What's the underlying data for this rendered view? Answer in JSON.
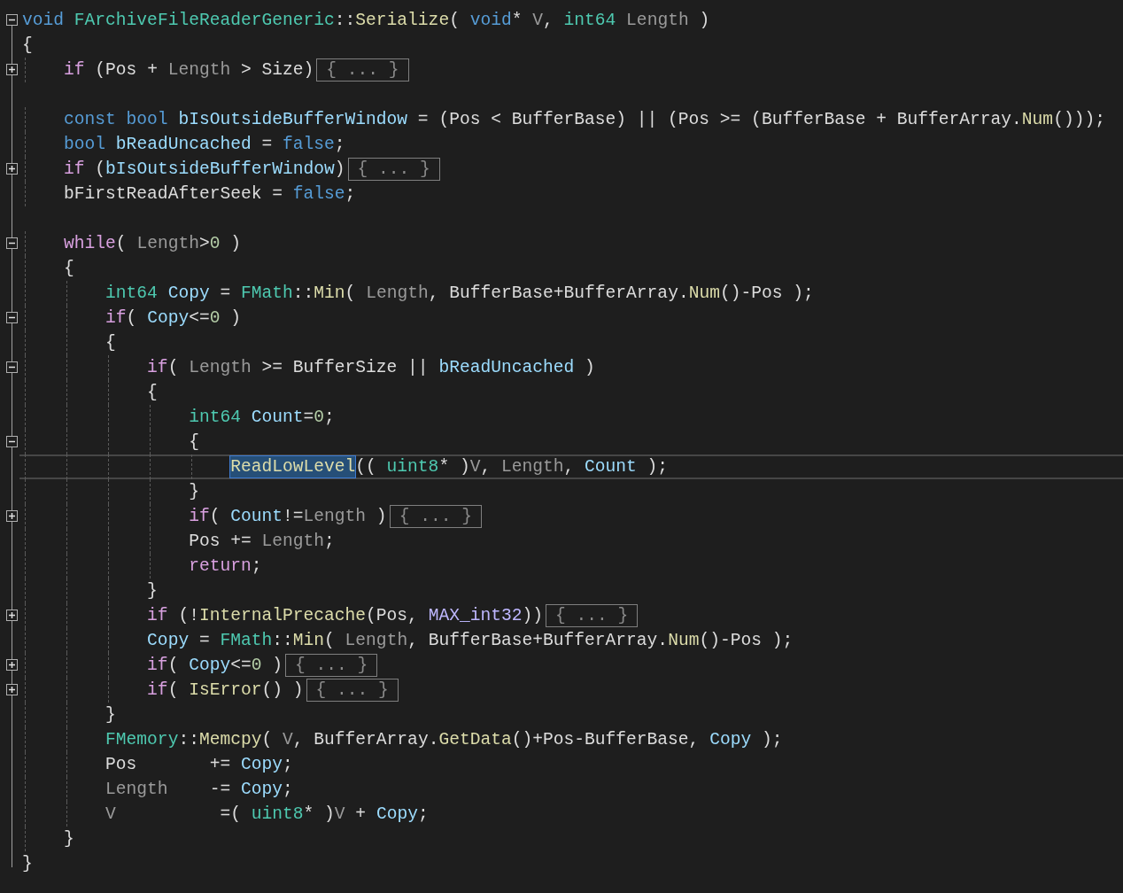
{
  "editor": {
    "lines": [
      {
        "kind": "code",
        "expanded": true,
        "tokens": [
          {
            "text": "void ",
            "kind": "kw"
          },
          {
            "text": "FArchiveFileReaderGeneric",
            "kind": "type"
          },
          {
            "text": "::",
            "kind": "plain"
          },
          {
            "text": "Serialize",
            "kind": "fn"
          },
          {
            "text": "( ",
            "kind": "plain"
          },
          {
            "text": "void",
            "kind": "kw"
          },
          {
            "text": "* ",
            "kind": "plain"
          },
          {
            "text": "V",
            "kind": "param"
          },
          {
            "text": ", ",
            "kind": "plain"
          },
          {
            "text": "int64 ",
            "kind": "type"
          },
          {
            "text": "Length",
            "kind": "param"
          },
          {
            "text": " )",
            "kind": "plain"
          }
        ]
      },
      {
        "kind": "code",
        "tokens": [
          {
            "text": "{",
            "kind": "plain"
          }
        ]
      },
      {
        "kind": "code",
        "expanded": false,
        "collapsed_text": "{ ... }",
        "tokens": [
          {
            "text": "    if",
            "kind": "ctrl"
          },
          {
            "text": " (Pos + ",
            "kind": "plain"
          },
          {
            "text": "Length",
            "kind": "param"
          },
          {
            "text": " > Size)",
            "kind": "plain"
          }
        ]
      },
      {
        "kind": "blank"
      },
      {
        "kind": "code",
        "tokens": [
          {
            "text": "    const bool ",
            "kind": "kw"
          },
          {
            "text": "bIsOutsideBufferWindow",
            "kind": "local"
          },
          {
            "text": " = (Pos < BufferBase) || (Pos >= (BufferBase + BufferArray.",
            "kind": "plain"
          },
          {
            "text": "Num",
            "kind": "fn"
          },
          {
            "text": "()));",
            "kind": "plain"
          }
        ]
      },
      {
        "kind": "code",
        "tokens": [
          {
            "text": "    bool ",
            "kind": "kw"
          },
          {
            "text": "bReadUncached",
            "kind": "local"
          },
          {
            "text": " = ",
            "kind": "plain"
          },
          {
            "text": "false",
            "kind": "kw"
          },
          {
            "text": ";",
            "kind": "plain"
          }
        ]
      },
      {
        "kind": "code",
        "expanded": false,
        "collapsed_text": "{ ... }",
        "tokens": [
          {
            "text": "    if",
            "kind": "ctrl"
          },
          {
            "text": " (",
            "kind": "plain"
          },
          {
            "text": "bIsOutsideBufferWindow",
            "kind": "local"
          },
          {
            "text": ")",
            "kind": "plain"
          }
        ]
      },
      {
        "kind": "code",
        "tokens": [
          {
            "text": "    bFirstReadAfterSeek = ",
            "kind": "plain"
          },
          {
            "text": "false",
            "kind": "kw"
          },
          {
            "text": ";",
            "kind": "plain"
          }
        ]
      },
      {
        "kind": "blank"
      },
      {
        "kind": "code",
        "expanded": true,
        "tokens": [
          {
            "text": "    while",
            "kind": "ctrl"
          },
          {
            "text": "( ",
            "kind": "plain"
          },
          {
            "text": "Length",
            "kind": "param"
          },
          {
            "text": ">",
            "kind": "plain"
          },
          {
            "text": "0",
            "kind": "num"
          },
          {
            "text": " )",
            "kind": "plain"
          }
        ]
      },
      {
        "kind": "code",
        "tokens": [
          {
            "text": "    {",
            "kind": "plain"
          }
        ]
      },
      {
        "kind": "code",
        "tokens": [
          {
            "text": "        int64 ",
            "kind": "type"
          },
          {
            "text": "Copy",
            "kind": "local"
          },
          {
            "text": " = ",
            "kind": "plain"
          },
          {
            "text": "FMath",
            "kind": "type"
          },
          {
            "text": "::",
            "kind": "plain"
          },
          {
            "text": "Min",
            "kind": "fn"
          },
          {
            "text": "( ",
            "kind": "plain"
          },
          {
            "text": "Length",
            "kind": "param"
          },
          {
            "text": ", BufferBase+BufferArray.",
            "kind": "plain"
          },
          {
            "text": "Num",
            "kind": "fn"
          },
          {
            "text": "()-Pos );",
            "kind": "plain"
          }
        ]
      },
      {
        "kind": "code",
        "expanded": true,
        "tokens": [
          {
            "text": "        if",
            "kind": "ctrl"
          },
          {
            "text": "( ",
            "kind": "plain"
          },
          {
            "text": "Copy",
            "kind": "local"
          },
          {
            "text": "<=",
            "kind": "plain"
          },
          {
            "text": "0",
            "kind": "num"
          },
          {
            "text": " )",
            "kind": "plain"
          }
        ]
      },
      {
        "kind": "code",
        "tokens": [
          {
            "text": "        {",
            "kind": "plain"
          }
        ]
      },
      {
        "kind": "code",
        "expanded": true,
        "tokens": [
          {
            "text": "            if",
            "kind": "ctrl"
          },
          {
            "text": "( ",
            "kind": "plain"
          },
          {
            "text": "Length",
            "kind": "param"
          },
          {
            "text": " >= BufferSize || ",
            "kind": "plain"
          },
          {
            "text": "bReadUncached",
            "kind": "local"
          },
          {
            "text": " )",
            "kind": "plain"
          }
        ]
      },
      {
        "kind": "code",
        "tokens": [
          {
            "text": "            {",
            "kind": "plain"
          }
        ]
      },
      {
        "kind": "code",
        "tokens": [
          {
            "text": "                int64 ",
            "kind": "type"
          },
          {
            "text": "Count",
            "kind": "local"
          },
          {
            "text": "=",
            "kind": "plain"
          },
          {
            "text": "0",
            "kind": "num"
          },
          {
            "text": ";",
            "kind": "plain"
          }
        ]
      },
      {
        "kind": "code",
        "expanded": true,
        "tokens": [
          {
            "text": "                {",
            "kind": "plain"
          }
        ]
      },
      {
        "kind": "code",
        "current": true,
        "tokens": [
          {
            "text": "                    ReadLowLevel",
            "kind": "fn",
            "highlighted": true
          },
          {
            "text": "(( ",
            "kind": "plain"
          },
          {
            "text": "uint8",
            "kind": "type"
          },
          {
            "text": "* )",
            "kind": "plain"
          },
          {
            "text": "V",
            "kind": "param"
          },
          {
            "text": ", ",
            "kind": "plain"
          },
          {
            "text": "Length",
            "kind": "param"
          },
          {
            "text": ", ",
            "kind": "plain"
          },
          {
            "text": "Count",
            "kind": "local"
          },
          {
            "text": " );",
            "kind": "plain"
          }
        ]
      },
      {
        "kind": "code",
        "tokens": [
          {
            "text": "                }",
            "kind": "plain"
          }
        ]
      },
      {
        "kind": "code",
        "expanded": false,
        "collapsed_text": "{ ... }",
        "tokens": [
          {
            "text": "                if",
            "kind": "ctrl"
          },
          {
            "text": "( ",
            "kind": "plain"
          },
          {
            "text": "Count",
            "kind": "local"
          },
          {
            "text": "!=",
            "kind": "plain"
          },
          {
            "text": "Length",
            "kind": "param"
          },
          {
            "text": " )",
            "kind": "plain"
          }
        ]
      },
      {
        "kind": "code",
        "tokens": [
          {
            "text": "                Pos += ",
            "kind": "plain"
          },
          {
            "text": "Length",
            "kind": "param"
          },
          {
            "text": ";",
            "kind": "plain"
          }
        ]
      },
      {
        "kind": "code",
        "tokens": [
          {
            "text": "                return",
            "kind": "ctrl"
          },
          {
            "text": ";",
            "kind": "plain"
          }
        ]
      },
      {
        "kind": "code",
        "tokens": [
          {
            "text": "            }",
            "kind": "plain"
          }
        ]
      },
      {
        "kind": "code",
        "expanded": false,
        "collapsed_text": "{ ... }",
        "tokens": [
          {
            "text": "            if",
            "kind": "ctrl"
          },
          {
            "text": " (!",
            "kind": "plain"
          },
          {
            "text": "InternalPrecache",
            "kind": "fn"
          },
          {
            "text": "(Pos, ",
            "kind": "plain"
          },
          {
            "text": "MAX_int32",
            "kind": "macro"
          },
          {
            "text": "))",
            "kind": "plain"
          }
        ]
      },
      {
        "kind": "code",
        "tokens": [
          {
            "text": "            Copy",
            "kind": "local"
          },
          {
            "text": " = ",
            "kind": "plain"
          },
          {
            "text": "FMath",
            "kind": "type"
          },
          {
            "text": "::",
            "kind": "plain"
          },
          {
            "text": "Min",
            "kind": "fn"
          },
          {
            "text": "( ",
            "kind": "plain"
          },
          {
            "text": "Length",
            "kind": "param"
          },
          {
            "text": ", BufferBase+BufferArray.",
            "kind": "plain"
          },
          {
            "text": "Num",
            "kind": "fn"
          },
          {
            "text": "()-Pos );",
            "kind": "plain"
          }
        ]
      },
      {
        "kind": "code",
        "expanded": false,
        "collapsed_text": "{ ... }",
        "tokens": [
          {
            "text": "            if",
            "kind": "ctrl"
          },
          {
            "text": "( ",
            "kind": "plain"
          },
          {
            "text": "Copy",
            "kind": "local"
          },
          {
            "text": "<=",
            "kind": "plain"
          },
          {
            "text": "0",
            "kind": "num"
          },
          {
            "text": " )",
            "kind": "plain"
          }
        ]
      },
      {
        "kind": "code",
        "expanded": false,
        "collapsed_text": "{ ... }",
        "tokens": [
          {
            "text": "            if",
            "kind": "ctrl"
          },
          {
            "text": "( ",
            "kind": "plain"
          },
          {
            "text": "IsError",
            "kind": "fn"
          },
          {
            "text": "() )",
            "kind": "plain"
          }
        ]
      },
      {
        "kind": "code",
        "tokens": [
          {
            "text": "        }",
            "kind": "plain"
          }
        ]
      },
      {
        "kind": "code",
        "tokens": [
          {
            "text": "        FMemory",
            "kind": "type"
          },
          {
            "text": "::",
            "kind": "plain"
          },
          {
            "text": "Memcpy",
            "kind": "fn"
          },
          {
            "text": "( ",
            "kind": "plain"
          },
          {
            "text": "V",
            "kind": "param"
          },
          {
            "text": ", BufferArray.",
            "kind": "plain"
          },
          {
            "text": "GetData",
            "kind": "fn"
          },
          {
            "text": "()+Pos-BufferBase, ",
            "kind": "plain"
          },
          {
            "text": "Copy",
            "kind": "local"
          },
          {
            "text": " );",
            "kind": "plain"
          }
        ]
      },
      {
        "kind": "code",
        "tokens": [
          {
            "text": "        Pos       += ",
            "kind": "plain"
          },
          {
            "text": "Copy",
            "kind": "local"
          },
          {
            "text": ";",
            "kind": "plain"
          }
        ]
      },
      {
        "kind": "code",
        "tokens": [
          {
            "text": "        Length",
            "kind": "param"
          },
          {
            "text": "    -= ",
            "kind": "plain"
          },
          {
            "text": "Copy",
            "kind": "local"
          },
          {
            "text": ";",
            "kind": "plain"
          }
        ]
      },
      {
        "kind": "code",
        "tokens": [
          {
            "text": "        V",
            "kind": "param"
          },
          {
            "text": "          =( ",
            "kind": "plain"
          },
          {
            "text": "uint8",
            "kind": "type"
          },
          {
            "text": "* )",
            "kind": "plain"
          },
          {
            "text": "V",
            "kind": "param"
          },
          {
            "text": " + ",
            "kind": "plain"
          },
          {
            "text": "Copy",
            "kind": "local"
          },
          {
            "text": ";",
            "kind": "plain"
          }
        ]
      },
      {
        "kind": "code",
        "tokens": [
          {
            "text": "    }",
            "kind": "plain"
          }
        ]
      },
      {
        "kind": "code",
        "tokens": [
          {
            "text": "}",
            "kind": "plain"
          }
        ]
      }
    ]
  }
}
